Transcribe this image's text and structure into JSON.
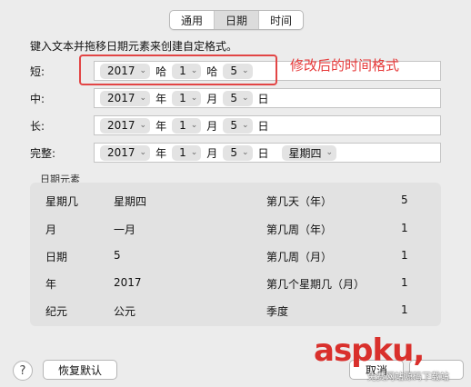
{
  "tabs": [
    {
      "label": "通用",
      "selected": false
    },
    {
      "label": "日期",
      "selected": true
    },
    {
      "label": "时间",
      "selected": false
    }
  ],
  "instruction": "键入文本并拖移日期元素来创建自定格式。",
  "formats": {
    "short": {
      "label": "短:",
      "year": "2017",
      "sep1": "哈",
      "month": "1",
      "sep2": "哈",
      "day": "5"
    },
    "medium": {
      "label": "中:",
      "year": "2017",
      "sep1": "年",
      "month": "1",
      "sep2": "月",
      "day": "5",
      "sep3": "日"
    },
    "long": {
      "label": "长:",
      "year": "2017",
      "sep1": "年",
      "month": "1",
      "sep2": "月",
      "day": "5",
      "sep3": "日"
    },
    "full": {
      "label": "完整:",
      "year": "2017",
      "sep1": "年",
      "month": "1",
      "sep2": "月",
      "day": "5",
      "sep3": "日",
      "weekday": "星期四"
    }
  },
  "annotation": {
    "text": "修改后的时间格式",
    "color": "#e63a3a"
  },
  "date_elements": {
    "title": "日期元素",
    "left": [
      {
        "label": "星期几",
        "value": "星期四"
      },
      {
        "label": "月",
        "value": "一月"
      },
      {
        "label": "日期",
        "value": "5"
      },
      {
        "label": "年",
        "value": "2017"
      },
      {
        "label": "纪元",
        "value": "公元"
      }
    ],
    "right": [
      {
        "label": "第几天（年）",
        "value": "5"
      },
      {
        "label": "第几周（年）",
        "value": "1"
      },
      {
        "label": "第几周（月）",
        "value": "1"
      },
      {
        "label": "第几个星期几（月）",
        "value": "1"
      },
      {
        "label": "季度",
        "value": "1"
      }
    ]
  },
  "buttons": {
    "help": "?",
    "restore": "恢复默认",
    "cancel": "取消"
  },
  "watermark": {
    "main": "asp",
    "accent": "ku",
    "suffix": ",",
    "sub": "免费网站源码下载站"
  }
}
